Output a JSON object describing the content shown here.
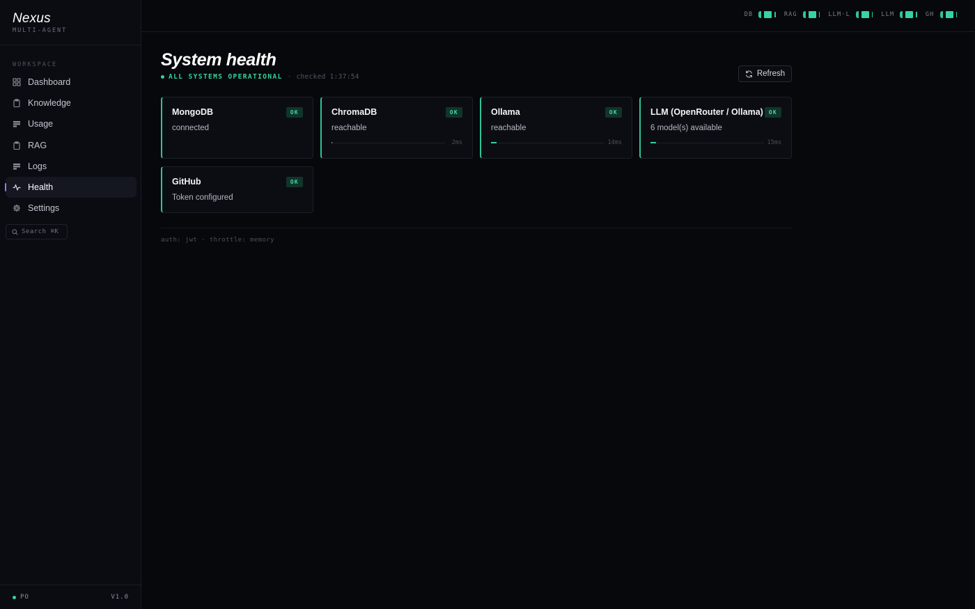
{
  "brand": {
    "name": "Nexus",
    "subtitle": "MULTI-AGENT"
  },
  "sidebar": {
    "section_label": "WORKSPACE",
    "items": [
      {
        "label": "Dashboard",
        "icon": "grid-icon"
      },
      {
        "label": "Knowledge",
        "icon": "clipboard-icon"
      },
      {
        "label": "Usage",
        "icon": "chart-icon"
      },
      {
        "label": "RAG",
        "icon": "clipboard-icon"
      },
      {
        "label": "Logs",
        "icon": "list-icon"
      },
      {
        "label": "Health",
        "icon": "pulse-icon",
        "active": true
      },
      {
        "label": "Settings",
        "icon": "gear-icon"
      }
    ],
    "search": {
      "label": "Search",
      "shortcut": "⌘K"
    },
    "footer": {
      "user": "PO",
      "version": "V1.0"
    }
  },
  "topbar": {
    "indicators": [
      {
        "label": "DB"
      },
      {
        "label": "RAG"
      },
      {
        "label": "LLM·L"
      },
      {
        "label": "LLM"
      },
      {
        "label": "GH"
      }
    ]
  },
  "page": {
    "title": "System health",
    "status": "ALL SYSTEMS OPERATIONAL",
    "separator": "·",
    "checked": "checked 1:37:54",
    "refresh_label": "Refresh"
  },
  "services": [
    {
      "name": "MongoDB",
      "status": "OK",
      "detail": "connected"
    },
    {
      "name": "ChromaDB",
      "status": "OK",
      "detail": "reachable",
      "latency": "2ms",
      "latency_ms": 2
    },
    {
      "name": "Ollama",
      "status": "OK",
      "detail": "reachable",
      "latency": "14ms",
      "latency_ms": 14
    },
    {
      "name": "LLM (OpenRouter / Ollama)",
      "status": "OK",
      "detail": "6 model(s) available",
      "latency": "15ms",
      "latency_ms": 15
    },
    {
      "name": "GitHub",
      "status": "OK",
      "detail": "Token configured"
    }
  ],
  "footer_meta": "auth: jwt · throttle: memory",
  "colors": {
    "ok": "#34d39a",
    "accent": "#8b7cf6",
    "background": "#07080b"
  }
}
